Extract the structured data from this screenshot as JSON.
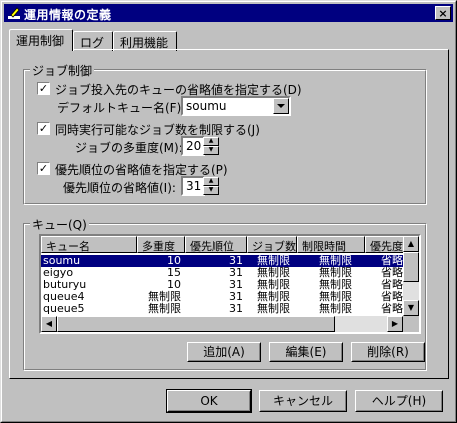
{
  "window": {
    "title": "運用情報の定義",
    "close_glyph": "×",
    "icon": "pencil-icon"
  },
  "tabs": [
    {
      "label": "運用制御",
      "active": true
    },
    {
      "label": "ログ",
      "active": false
    },
    {
      "label": "利用機能",
      "active": false
    }
  ],
  "job_group": {
    "title": "ジョブ制御",
    "queue_default_check": {
      "label": "ジョブ投入先のキューの省略値を指定する(D)",
      "checked": true
    },
    "default_queue_label": "デフォルトキュー名(F):",
    "default_queue_value": "soumu",
    "concurrency_check": {
      "label": "同時実行可能なジョブ数を制限する(J)",
      "checked": true
    },
    "multiplicity_label": "ジョブの多重度(M):",
    "multiplicity_value": "20",
    "priority_check": {
      "label": "優先順位の省略値を指定する(P)",
      "checked": true
    },
    "priority_label": "優先順位の省略値(I):",
    "priority_value": "31"
  },
  "queue_group": {
    "title": "キュー(Q)",
    "columns": [
      "キュー名",
      "多重度",
      "優先順位",
      "ジョブ数",
      "制限時間",
      "優先度"
    ],
    "rows": [
      {
        "name": "soumu",
        "multi": "10",
        "prio": "31",
        "jobs": "無制限",
        "limit": "無制限",
        "pri": "省略",
        "selected": true
      },
      {
        "name": "eigyo",
        "multi": "15",
        "prio": "31",
        "jobs": "無制限",
        "limit": "無制限",
        "pri": "省略",
        "selected": false
      },
      {
        "name": "buturyu",
        "multi": "10",
        "prio": "31",
        "jobs": "無制限",
        "limit": "無制限",
        "pri": "省略",
        "selected": false
      },
      {
        "name": "queue4",
        "multi": "無制限",
        "prio": "31",
        "jobs": "無制限",
        "limit": "無制限",
        "pri": "省略",
        "selected": false
      },
      {
        "name": "queue5",
        "multi": "無制限",
        "prio": "31",
        "jobs": "無制限",
        "limit": "無制限",
        "pri": "省略",
        "selected": false
      }
    ],
    "add_button": "追加(A)",
    "edit_button": "編集(E)",
    "delete_button": "削除(R)"
  },
  "footer": {
    "ok": "OK",
    "cancel": "キャンセル",
    "help": "ヘルプ(H)"
  }
}
